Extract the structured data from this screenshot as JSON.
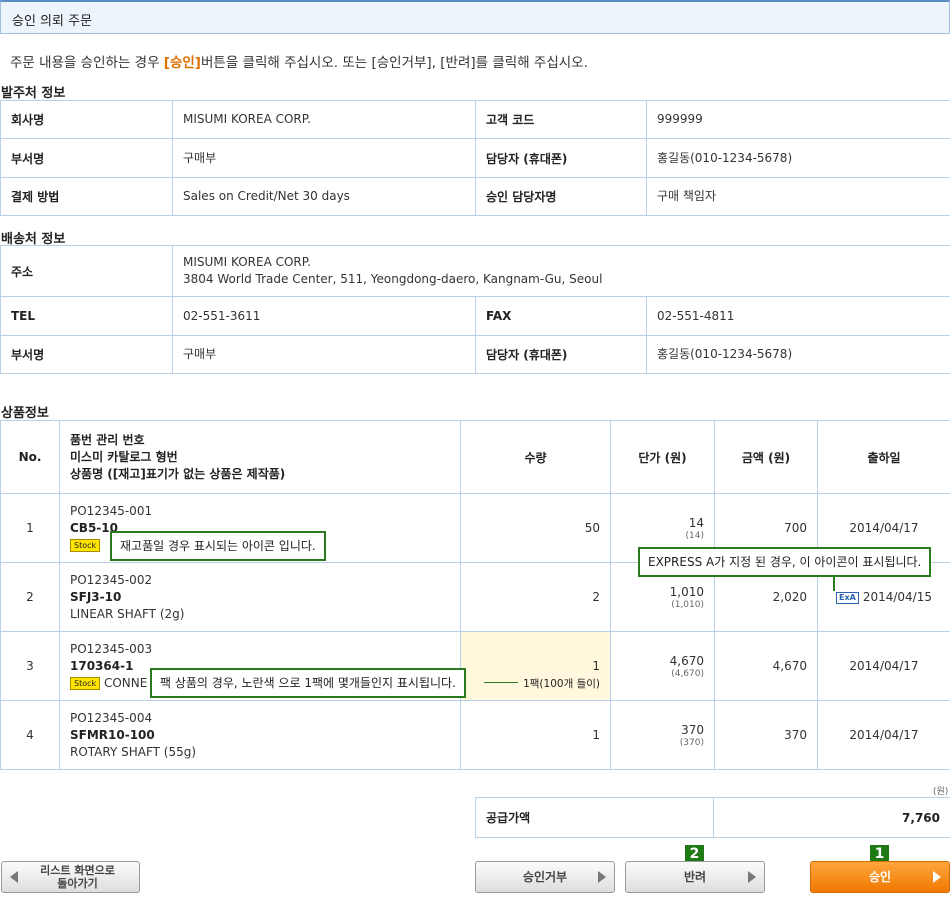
{
  "page": {
    "title": "승인 의뢰 주문",
    "intro_before": "주문 내용을 승인하는 경우 ",
    "intro_highlight": "[승인]",
    "intro_after": "버튼을 클릭해 주십시오. 또는 [승인거부], [반려]를 클릭해 주십시오."
  },
  "order_info": {
    "heading": "발주처 정보",
    "company_label": "회사명",
    "company": "MISUMI KOREA CORP.",
    "customer_code_label": "고객 코드",
    "customer_code": "999999",
    "dept_label": "부서명",
    "dept": "구매부",
    "contact_label": "담당자 (휴대폰)",
    "contact": "홍길동(010-1234-5678)",
    "payment_label": "결제 방법",
    "payment": "Sales on Credit/Net 30 days",
    "approver_label": "승인 담당자명",
    "approver": "구매 책임자"
  },
  "ship_info": {
    "heading": "배송처 정보",
    "address_label": "주소",
    "address_line1": "MISUMI KOREA CORP.",
    "address_line2": "3804 World Trade Center, 511, Yeongdong-daero, Kangnam-Gu, Seoul",
    "tel_label": "TEL",
    "tel": "02-551-3611",
    "fax_label": "FAX",
    "fax": "02-551-4811",
    "dept_label": "부서명",
    "dept": "구매부",
    "contact_label": "담당자 (휴대폰)",
    "contact": "홍길동(010-1234-5678)"
  },
  "products": {
    "heading": "상품정보",
    "headers": {
      "no": "No.",
      "item_line1": "품번 관리 번호",
      "item_line2": "미스미 카탈로그 형번",
      "item_line3": "상품명 ([재고]표기가 없는 상품은 제작품)",
      "qty": "수량",
      "unit_price": "단가 (원)",
      "amount": "금액 (원)",
      "ship_date": "출하일"
    },
    "rows": [
      {
        "no": "1",
        "po": "PO12345-001",
        "part": "CB5-10",
        "stock": "Stock",
        "name": "",
        "qty": "50",
        "price": "14",
        "price_sub": "(14)",
        "amount": "700",
        "date": "2014/04/17"
      },
      {
        "no": "2",
        "po": "PO12345-002",
        "part": "SFJ3-10",
        "name": "LINEAR SHAFT (2g)",
        "qty": "2",
        "price": "1,010",
        "price_sub": "(1,010)",
        "amount": "2,020",
        "date": "2014/04/15",
        "express": "ExA"
      },
      {
        "no": "3",
        "po": "PO12345-003",
        "part": "170364-1",
        "stock": "Stock",
        "name": "CONNE",
        "qty": "1",
        "pack": "1팩(100개 들이)",
        "price": "4,670",
        "price_sub": "(4,670)",
        "amount": "4,670",
        "date": "2014/04/17"
      },
      {
        "no": "4",
        "po": "PO12345-004",
        "part": "SFMR10-100",
        "name": "ROTARY SHAFT (55g)",
        "qty": "1",
        "price": "370",
        "price_sub": "(370)",
        "amount": "370",
        "date": "2014/04/17"
      }
    ]
  },
  "callouts": {
    "stock": "재고품일 경우 표시되는 아이콘 입니다.",
    "express": "EXPRESS A가 지정 된 경우, 이 아이콘이 표시됩니다.",
    "pack": "팩 상품의 경우, 노란색 으로 1팩에 몇개들인지 표시됩니다."
  },
  "totals": {
    "unit": "(원)",
    "supply_label": "공급가액",
    "supply_value": "7,760"
  },
  "buttons": {
    "back": "리스트 화면으로 돌아가기",
    "back_line1": "리스트 화면으로",
    "back_line2": "돌아가기",
    "reject": "승인거부",
    "return": "반려",
    "approve": "승인",
    "badge_return": "2",
    "badge_approve": "1"
  },
  "colors": {
    "accent_orange": "#f07800",
    "callout_green": "#2a7a1e",
    "border_blue": "#b9d1e8",
    "pack_yellow": "#fff8dc"
  }
}
